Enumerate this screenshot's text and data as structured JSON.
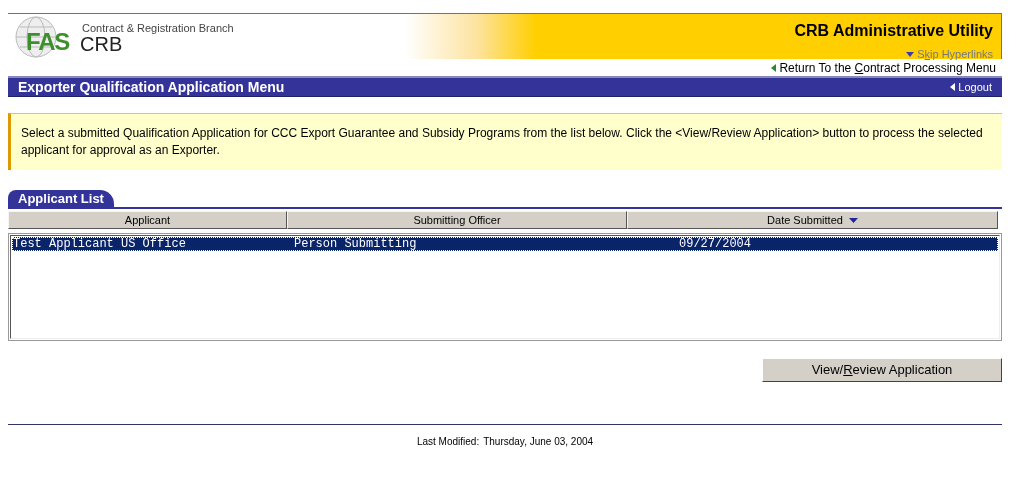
{
  "header": {
    "logo_mark": "FAS",
    "logo_text": "CRB",
    "branch": "Contract & Registration Branch",
    "title": "CRB Administrative Utility",
    "skip_link": [
      "S",
      "k",
      "ip Hyperlinks"
    ]
  },
  "return_link": [
    "Return To the ",
    "C",
    "ontract Processing Menu"
  ],
  "menu_bar": {
    "title": "Exporter Qualification Application Menu",
    "logout": "Logout"
  },
  "instructions": "Select a submitted Qualification Application for CCC Export Guarantee and Subsidy Programs from the list below.  Click the <View/Review Application> button to process the selected applicant for approval as an Exporter.",
  "list_tab": "Applicant List",
  "columns": [
    {
      "label": "Applicant",
      "sorted": false
    },
    {
      "label": "Submitting Officer",
      "sorted": false
    },
    {
      "label": "Date Submitted",
      "sorted": true
    }
  ],
  "rows": [
    {
      "selected": true,
      "cells": [
        "Test Applicant US Office",
        "Person Submitting",
        "09/27/2004"
      ]
    }
  ],
  "action_button": [
    "View/",
    "R",
    "eview Application"
  ],
  "footer": {
    "label": "Last Modified:",
    "date": "Thursday, June 03, 2004"
  }
}
